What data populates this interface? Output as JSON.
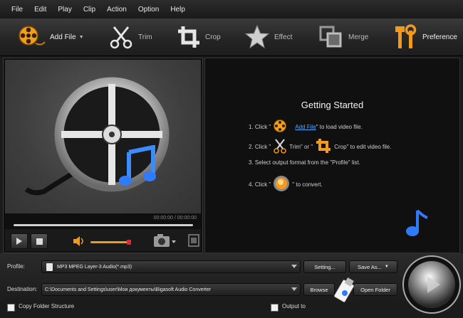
{
  "menu": [
    "File",
    "Edit",
    "Play",
    "Clip",
    "Action",
    "Option",
    "Help"
  ],
  "toolbar": {
    "add_file": "Add File",
    "trim": "Trim",
    "crop": "Crop",
    "effect": "Effect",
    "merge": "Merge",
    "preference": "Preference"
  },
  "player": {
    "timecode": "00:00:00 / 00:00:00"
  },
  "getting_started": {
    "title": "Getting Started",
    "step1_pre": "1. Click \"",
    "step1_link": "Add File",
    "step1_post": "\" to load video file.",
    "step2_pre": "2. Click \"",
    "step2_mid1": "Trim\" or \"",
    "step2_mid2": "Crop\" to edit video file.",
    "step3": "3. Select output format from the \"Profile\" list.",
    "step4_pre": "4. Click \"",
    "step4_post": "\" to convert."
  },
  "bottom": {
    "profile_label": "Profile:",
    "profile_value": "MP3 MPEG Layer-3 Audio(*.mp3)",
    "setting_button": "Setting...",
    "save_as_button": "Save As...",
    "destination_label": "Destination:",
    "destination_value": "C:\\Documents and Settings\\user\\Мои документы\\Bigasoft Audio Converter",
    "browse_button": "Browse",
    "open_folder_button": "Open Folder",
    "copy_folder_label": "Copy Folder Structure",
    "output_label": "Output to"
  },
  "colors": {
    "accent_orange": "#f39a1e",
    "link_blue": "#55a8ff",
    "note_blue": "#2f7bff"
  },
  "icons": [
    "film-reel-icon",
    "scissors-icon",
    "crop-icon",
    "star-icon",
    "merge-icon",
    "tools-icon",
    "music-note-icon",
    "play-icon",
    "stop-icon",
    "volume-icon",
    "camera-icon",
    "convert-icon",
    "usb-icon"
  ]
}
